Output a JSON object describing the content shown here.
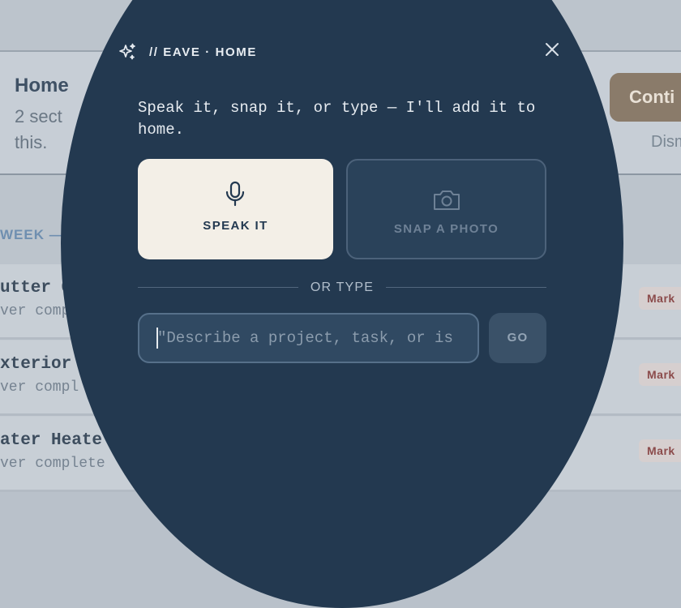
{
  "background": {
    "card": {
      "title": "Home",
      "subtitle": "2 sect this.",
      "continue_label": "Conti",
      "dismiss_label": "Dism"
    },
    "week_label": "WEEK —",
    "rows": [
      {
        "title": "utter C",
        "subtitle": "ver compl",
        "action": "Mark"
      },
      {
        "title": "xterior",
        "subtitle": "ver compl",
        "action": "Mark"
      },
      {
        "title": "ater Heate",
        "subtitle": "ver complete",
        "action": "Mark"
      }
    ]
  },
  "modal": {
    "title": "// EAVE · HOME",
    "prompt": "Speak it, snap it, or type — I'll add it to home.",
    "speak_label": "SPEAK IT",
    "snap_label": "SNAP A PHOTO",
    "divider_label": "OR TYPE",
    "input": {
      "value": "",
      "placeholder": "\"Describe a project, task, or is"
    },
    "go_label": "GO"
  },
  "colors": {
    "modal_bg": "#233950",
    "speak_bg": "#f3efe7",
    "accent_text": "#e6ebf0"
  }
}
